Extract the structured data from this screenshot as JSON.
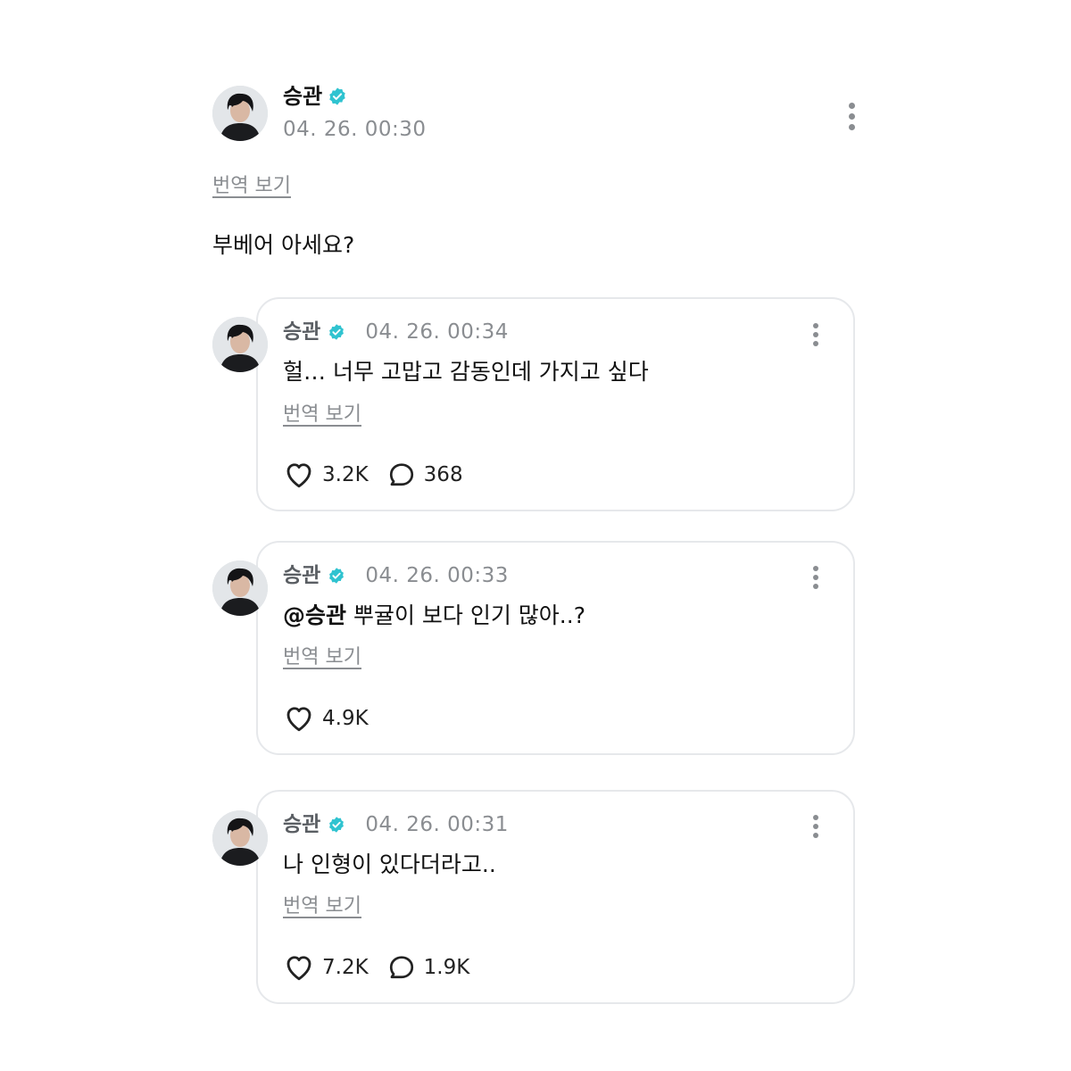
{
  "post": {
    "author": "승관",
    "timestamp": "04. 26. 00:30",
    "translate_label": "번역 보기",
    "body": "부베어 아세요?"
  },
  "icons": {
    "verified": "verified-badge-icon",
    "more": "more-vertical-icon",
    "like": "heart-icon",
    "reply": "comment-bubble-icon"
  },
  "colors": {
    "verified": "#2fc3d0",
    "muted": "#8a8d91",
    "border": "#e6e8eb"
  },
  "comments": [
    {
      "author": "승관",
      "timestamp": "04. 26. 00:34",
      "mention": "",
      "text": "헐… 너무 고맙고 감동인데 가지고 싶다",
      "translate_label": "번역 보기",
      "likes": "3.2K",
      "replies": "368"
    },
    {
      "author": "승관",
      "timestamp": "04. 26. 00:33",
      "mention": "@승관",
      "text": " 뿌귤이 보다 인기 많아..?",
      "translate_label": "번역 보기",
      "likes": "4.9K",
      "replies": ""
    },
    {
      "author": "승관",
      "timestamp": "04. 26. 00:31",
      "mention": "",
      "text": "나 인형이 있다더라고..",
      "translate_label": "번역 보기",
      "likes": "7.2K",
      "replies": "1.9K"
    }
  ]
}
